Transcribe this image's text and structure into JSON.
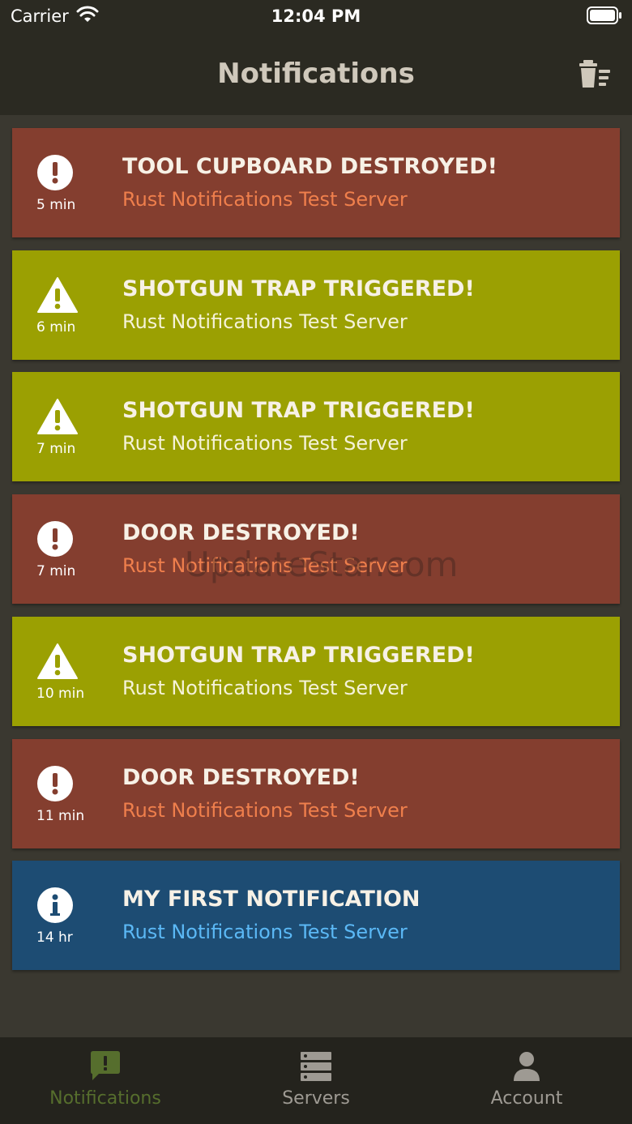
{
  "status_bar": {
    "carrier": "Carrier",
    "time": "12:04 PM"
  },
  "header": {
    "title": "Notifications",
    "clear_icon": "trash-icon"
  },
  "colors": {
    "danger": "#843e2f",
    "warning": "#9ba002",
    "info": "#1d4c73",
    "danger_sub": "#ef7f4c",
    "warning_sub": "#f5f2d8",
    "info_sub": "#5bb8f5",
    "tab_active": "#566e2d",
    "tab_inactive": "#9e9a93"
  },
  "notifications": [
    {
      "type": "danger",
      "icon": "alert-circle-icon",
      "age": "5 min",
      "title": "TOOL CUPBOARD DESTROYED!",
      "server": "Rust Notifications Test Server"
    },
    {
      "type": "warning",
      "icon": "warning-triangle-icon",
      "age": "6 min",
      "title": "SHOTGUN TRAP TRIGGERED!",
      "server": "Rust Notifications Test Server"
    },
    {
      "type": "warning",
      "icon": "warning-triangle-icon",
      "age": "7 min",
      "title": "SHOTGUN TRAP TRIGGERED!",
      "server": "Rust Notifications Test Server"
    },
    {
      "type": "danger",
      "icon": "alert-circle-icon",
      "age": "7 min",
      "title": "DOOR DESTROYED!",
      "server": "Rust Notifications Test Server"
    },
    {
      "type": "warning",
      "icon": "warning-triangle-icon",
      "age": "10 min",
      "title": "SHOTGUN TRAP TRIGGERED!",
      "server": "Rust Notifications Test Server"
    },
    {
      "type": "danger",
      "icon": "alert-circle-icon",
      "age": "11 min",
      "title": "DOOR DESTROYED!",
      "server": "Rust Notifications Test Server"
    },
    {
      "type": "info",
      "icon": "info-circle-icon",
      "age": "14 hr",
      "title": "MY FIRST NOTIFICATION",
      "server": "Rust Notifications Test Server"
    }
  ],
  "watermark": "UpdateStar.com",
  "tabs": [
    {
      "label": "Notifications",
      "icon": "notification-bubble-icon",
      "active": true
    },
    {
      "label": "Servers",
      "icon": "server-icon",
      "active": false
    },
    {
      "label": "Account",
      "icon": "person-icon",
      "active": false
    }
  ]
}
